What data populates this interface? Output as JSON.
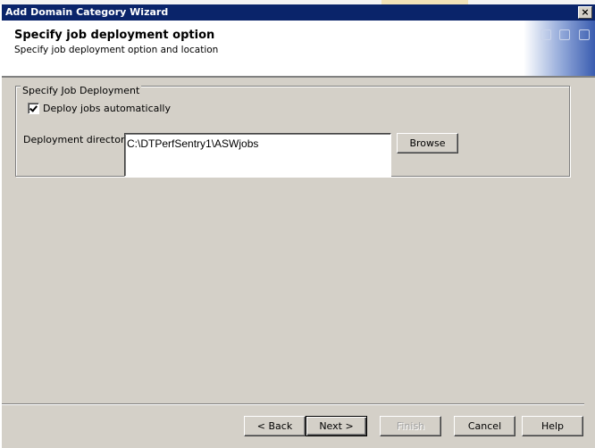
{
  "window": {
    "title": "Add Domain Category Wizard",
    "close_label": "×"
  },
  "header": {
    "title": "Specify job deployment option",
    "subtitle": "Specify job deployment option and location"
  },
  "group": {
    "legend": "Specify Job Deployment",
    "deploy_checkbox": {
      "label": "Deploy jobs automatically",
      "checked": true
    },
    "directory_label": "Deployment directory:",
    "directory_value": "C:\\DTPerfSentry1\\ASWjobs",
    "browse_label": "Browse"
  },
  "footer": {
    "back_label": "< Back",
    "next_label": "Next >",
    "finish_label": "Finish",
    "cancel_label": "Cancel",
    "help_label": "Help"
  }
}
